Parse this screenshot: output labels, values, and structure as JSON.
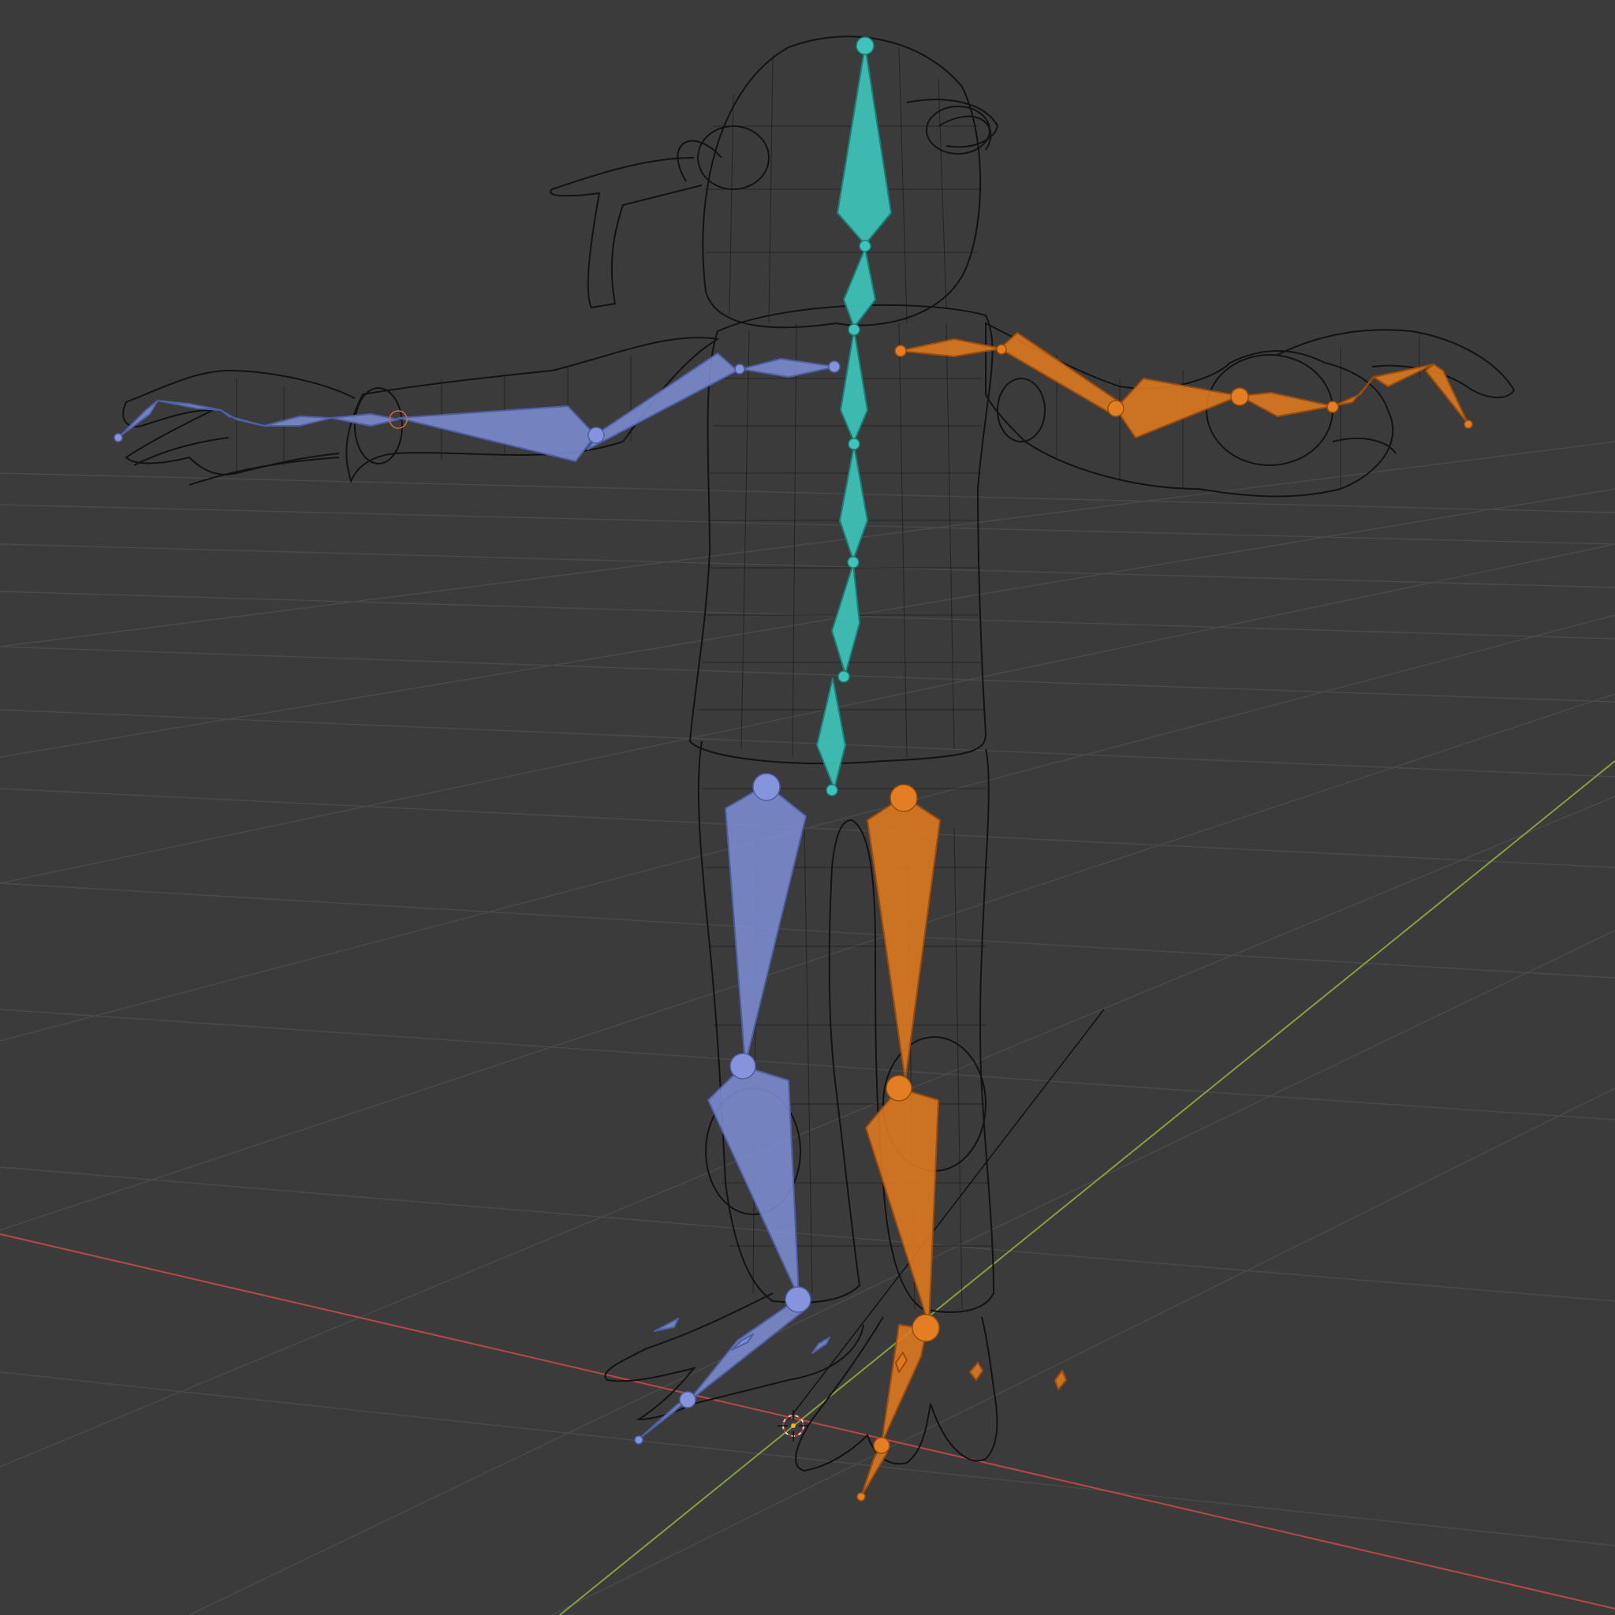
{
  "app": "3D viewport",
  "view": {
    "shading": "wireframe",
    "background": "#3b3b3b",
    "grid_color": "#4a4a4a",
    "x_axis_color": "#b84848",
    "y_axis_color": "#86a040",
    "mesh_color": "#121212"
  },
  "armature": {
    "groups": [
      {
        "name": "center",
        "color": "#3fc4bb",
        "stroke": "#1c7f79"
      },
      {
        "name": "left",
        "color": "#7f90d8",
        "stroke": "#4f5fa3"
      },
      {
        "name": "right",
        "color": "#e07a20",
        "stroke": "#9c4d0e"
      }
    ]
  },
  "icons": {
    "origin": "3d-cursor-icon"
  }
}
